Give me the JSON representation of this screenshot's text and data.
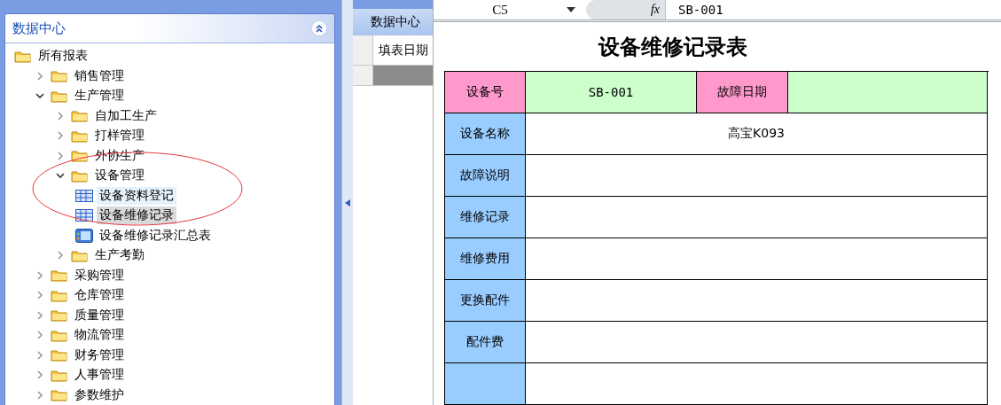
{
  "sidebar": {
    "title": "数据中心",
    "tree": [
      {
        "label": "所有报表",
        "kind": "folder",
        "selected": false,
        "hover": false,
        "children": [
          {
            "label": "销售管理",
            "kind": "folder",
            "expanded": false,
            "selected": false,
            "hover": false
          },
          {
            "label": "生产管理",
            "kind": "folder",
            "expanded": true,
            "selected": false,
            "hover": false,
            "children": [
              {
                "label": "自加工生产",
                "kind": "folder",
                "expanded": false,
                "selected": false,
                "hover": false
              },
              {
                "label": "打样管理",
                "kind": "folder",
                "expanded": false,
                "selected": false,
                "hover": false
              },
              {
                "label": "外协生产",
                "kind": "folder",
                "expanded": false,
                "selected": false,
                "hover": false
              },
              {
                "label": "设备管理",
                "kind": "folder",
                "expanded": true,
                "selected": false,
                "hover": false,
                "children": [
                  {
                    "label": "设备资料登记",
                    "kind": "table",
                    "selected": false,
                    "hover": true
                  },
                  {
                    "label": "设备维修记录",
                    "kind": "table",
                    "selected": true,
                    "hover": false
                  },
                  {
                    "label": "设备维修记录汇总表",
                    "kind": "report",
                    "selected": false,
                    "hover": false
                  }
                ]
              },
              {
                "label": "生产考勤",
                "kind": "folder",
                "expanded": false,
                "selected": false,
                "hover": false
              }
            ]
          },
          {
            "label": "采购管理",
            "kind": "folder",
            "expanded": false,
            "selected": false,
            "hover": false
          },
          {
            "label": "仓库管理",
            "kind": "folder",
            "expanded": false,
            "selected": false,
            "hover": false
          },
          {
            "label": "质量管理",
            "kind": "folder",
            "expanded": false,
            "selected": false,
            "hover": false
          },
          {
            "label": "物流管理",
            "kind": "folder",
            "expanded": false,
            "selected": false,
            "hover": false
          },
          {
            "label": "财务管理",
            "kind": "folder",
            "expanded": false,
            "selected": false,
            "hover": false
          },
          {
            "label": "人事管理",
            "kind": "folder",
            "expanded": false,
            "selected": false,
            "hover": false
          },
          {
            "label": "参数维护",
            "kind": "folder",
            "expanded": false,
            "selected": false,
            "hover": false
          }
        ]
      }
    ]
  },
  "middle": {
    "tab": "数据中心",
    "column_1": "填表日期"
  },
  "sheet": {
    "name_box": "C5",
    "fx_label": "fx",
    "formula": "SB-001",
    "title": "设备维修记录表",
    "rows": [
      {
        "label": "设备号",
        "value": "SB-001",
        "label_2": "故障日期"
      },
      {
        "label": "设备名称",
        "value": "高宝K093"
      },
      {
        "label": "故障说明"
      },
      {
        "label": "维修记录"
      },
      {
        "label": "维修费用"
      },
      {
        "label": "更换配件"
      },
      {
        "label": "配件费"
      },
      {}
    ]
  }
}
